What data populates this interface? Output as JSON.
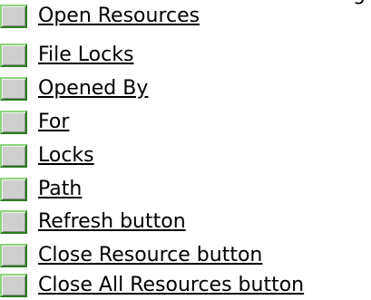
{
  "top_fragment": "g",
  "links": [
    {
      "label": "Open Resources"
    },
    {
      "label": "File Locks"
    },
    {
      "label": "Opened By"
    },
    {
      "label": "For"
    },
    {
      "label": "Locks"
    },
    {
      "label": "Path"
    },
    {
      "label": "Refresh button"
    },
    {
      "label": "Close Resource button"
    },
    {
      "label": "Close All Resources button"
    }
  ],
  "icon": "jump-square-icon",
  "colors": {
    "background": "#ffffff",
    "icon_fill": "#cfcfcf",
    "icon_border": "#4aa63a",
    "text": "#000000"
  }
}
